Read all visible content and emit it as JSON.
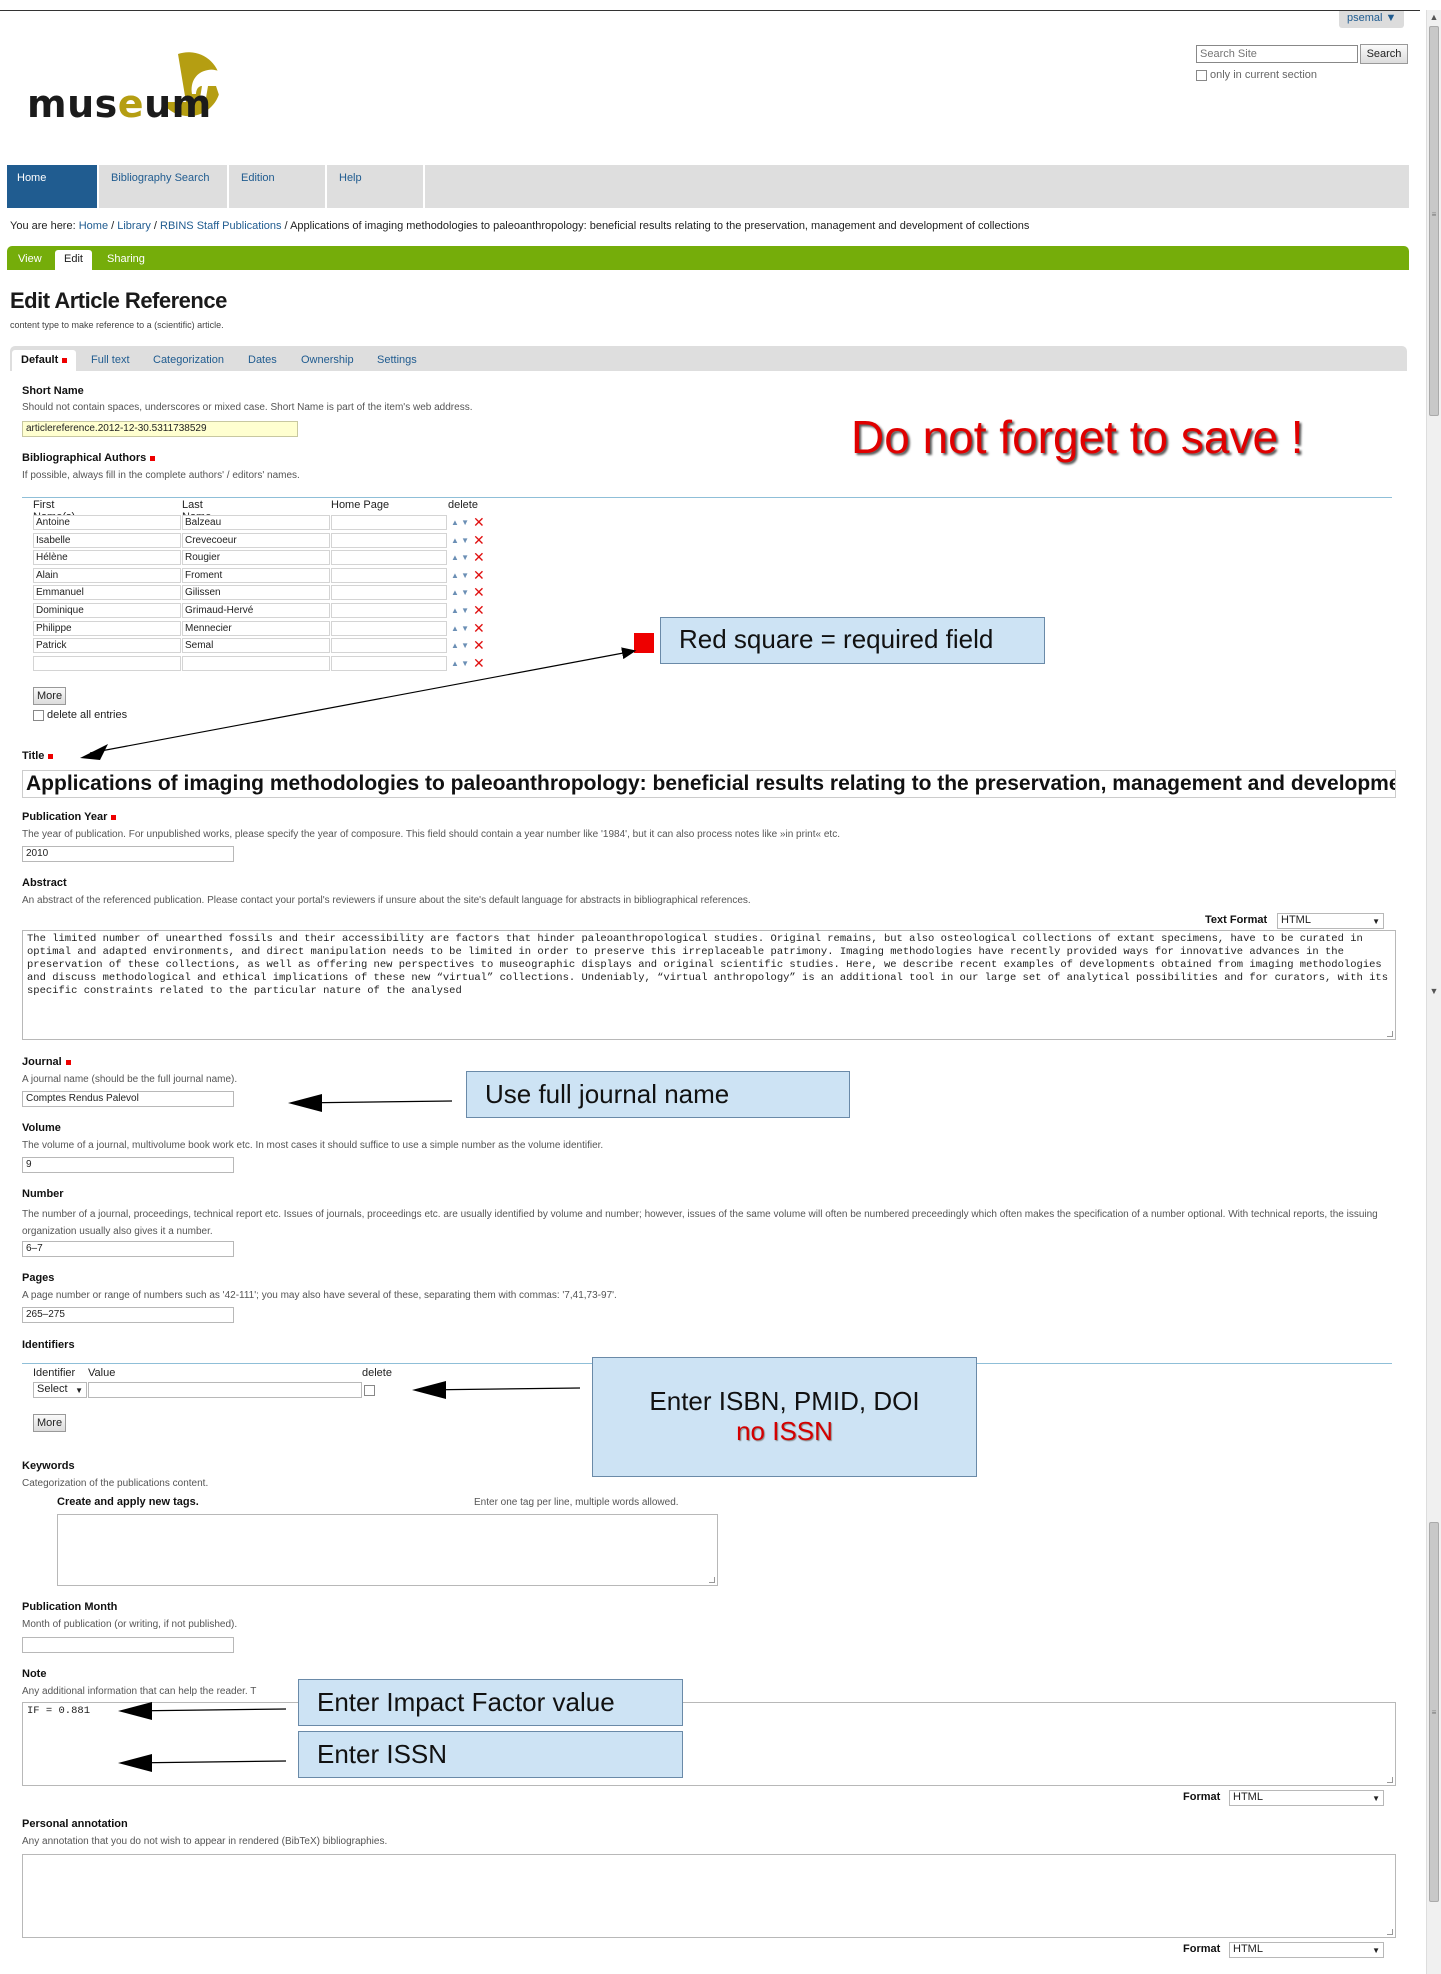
{
  "user_menu": "psemal ▼",
  "search": {
    "placeholder": "Search Site",
    "button": "Search",
    "only_section": "only in current section"
  },
  "logo": {
    "pre": "mus",
    "e": "e",
    "post": "um"
  },
  "nav": [
    "Home",
    "Bibliography Search",
    "Edition",
    "Help"
  ],
  "breadcrumb": {
    "prefix": "You are here:",
    "links": [
      "Home",
      "Library",
      "RBINS Staff Publications"
    ],
    "current": "Applications of imaging methodologies to paleoanthropology: beneficial results relating to the preservation, management and development of collections"
  },
  "edit_tabs": [
    "View",
    "Edit",
    "Sharing"
  ],
  "page": {
    "title": "Edit Article Reference",
    "description": "content type to make reference to a (scientific) article."
  },
  "form_tabs": [
    "Default",
    "Full text",
    "Categorization",
    "Dates",
    "Ownership",
    "Settings"
  ],
  "short_name": {
    "label": "Short Name",
    "help": "Should not contain spaces, underscores or mixed case. Short Name is part of the item's web address.",
    "value": "articlereference.2012-12-30.5311738529"
  },
  "authors": {
    "label": "Bibliographical Authors",
    "help": "If possible, always fill in the complete authors' / editors' names.",
    "columns": [
      "First Name(s)",
      "Last Name",
      "Home Page",
      "delete"
    ],
    "rows": [
      [
        "Antoine",
        "Balzeau"
      ],
      [
        "Isabelle",
        "Crevecoeur"
      ],
      [
        "Hélène",
        "Rougier"
      ],
      [
        "Alain",
        "Froment"
      ],
      [
        "Emmanuel",
        "Gilissen"
      ],
      [
        "Dominique",
        "Grimaud-Hervé"
      ],
      [
        "Philippe",
        "Mennecier"
      ],
      [
        "Patrick",
        "Semal"
      ],
      [
        "",
        ""
      ]
    ],
    "more": "More",
    "delete_all": "delete all entries"
  },
  "title_field": {
    "label": "Title",
    "value": "Applications of imaging methodologies to paleoanthropology: beneficial results relating to the preservation, management and development of collections"
  },
  "pub_year": {
    "label": "Publication Year",
    "help": "The year of publication. For unpublished works, please specify the year of composure. This field should contain a year number like '1984', but it can also process notes like »in print« etc.",
    "value": "2010"
  },
  "abstract": {
    "label": "Abstract",
    "help": "An abstract of the referenced publication. Please contact your portal's reviewers if unsure about the site's default language for abstracts in bibliographical references.",
    "format_label": "Text Format",
    "format_value": "HTML",
    "text": "The limited number of unearthed fossils and their accessibility are factors that hinder paleoanthropological studies. Original remains, but also osteological collections of extant specimens, have to be curated in optimal and adapted environments, and direct manipulation needs to be limited in order to preserve this irreplaceable patrimony. Imaging methodologies have recently provided ways for innovative advances in the preservation of these collections, as well as offering new perspectives to museographic displays and original scientific studies. Here, we describe recent examples of developments obtained from imaging methodologies and discuss methodological and ethical implications of these new “virtual” collections. Undeniably, “virtual anthropology” is an additional tool in our large set of analytical possibilities and for curators, with its specific constraints related to the particular nature of the analysed"
  },
  "journal": {
    "label": "Journal",
    "help": "A journal name (should be the full journal name).",
    "value": "Comptes Rendus Palevol"
  },
  "volume": {
    "label": "Volume",
    "help": "The volume of a journal, multivolume book work etc. In most cases it should suffice to use a simple number as the volume identifier.",
    "value": "9"
  },
  "number": {
    "label": "Number",
    "help": "The number of a journal, proceedings, technical report etc. Issues of journals, proceedings etc. are usually identified by volume and number; however, issues of the same volume will often be numbered preceedingly which often makes the specification of a number optional. With technical reports, the issuing organization usually also gives it a number.",
    "value": "6–7"
  },
  "pages": {
    "label": "Pages",
    "help": "A page number or range of numbers such as '42-111'; you may also have several of these, separating them with commas: '7,41,73-97'.",
    "value": "265–275"
  },
  "identifiers": {
    "label": "Identifiers",
    "col_identifier": "Identifier",
    "col_value": "Value",
    "col_delete": "delete",
    "select": "Select",
    "more": "More"
  },
  "keywords": {
    "label": "Keywords",
    "help": "Categorization of the publications content.",
    "sub_label": "Create and apply new tags.",
    "hint": "Enter one tag per line, multiple words allowed."
  },
  "pub_month": {
    "label": "Publication Month",
    "help": "Month of publication (or writing, if not published)."
  },
  "note": {
    "label": "Note",
    "help": "Any additional information that can help the reader. T",
    "text": "IF = 0.881",
    "format_label": "Format",
    "format_value": "HTML"
  },
  "personal": {
    "label": "Personal annotation",
    "help": "Any annotation that you do not wish to appear in rendered (BibTeX) bibliographies.",
    "format_label": "Format",
    "format_value": "HTML"
  },
  "annotations": {
    "save_warning": "Do not forget to save !",
    "required": "Red square = required field",
    "journal": "Use full journal name",
    "identifiers_line1": "Enter ISBN, PMID, DOI",
    "identifiers_line2": "no ISSN",
    "impact": "Enter Impact Factor value",
    "issn": "Enter ISSN"
  },
  "colors": {
    "nav_active": "#205c90",
    "edit_bar": "#75ad0a",
    "required": "#e00000",
    "callout": "#cde3f4",
    "logo_accent": "#b59e12"
  }
}
